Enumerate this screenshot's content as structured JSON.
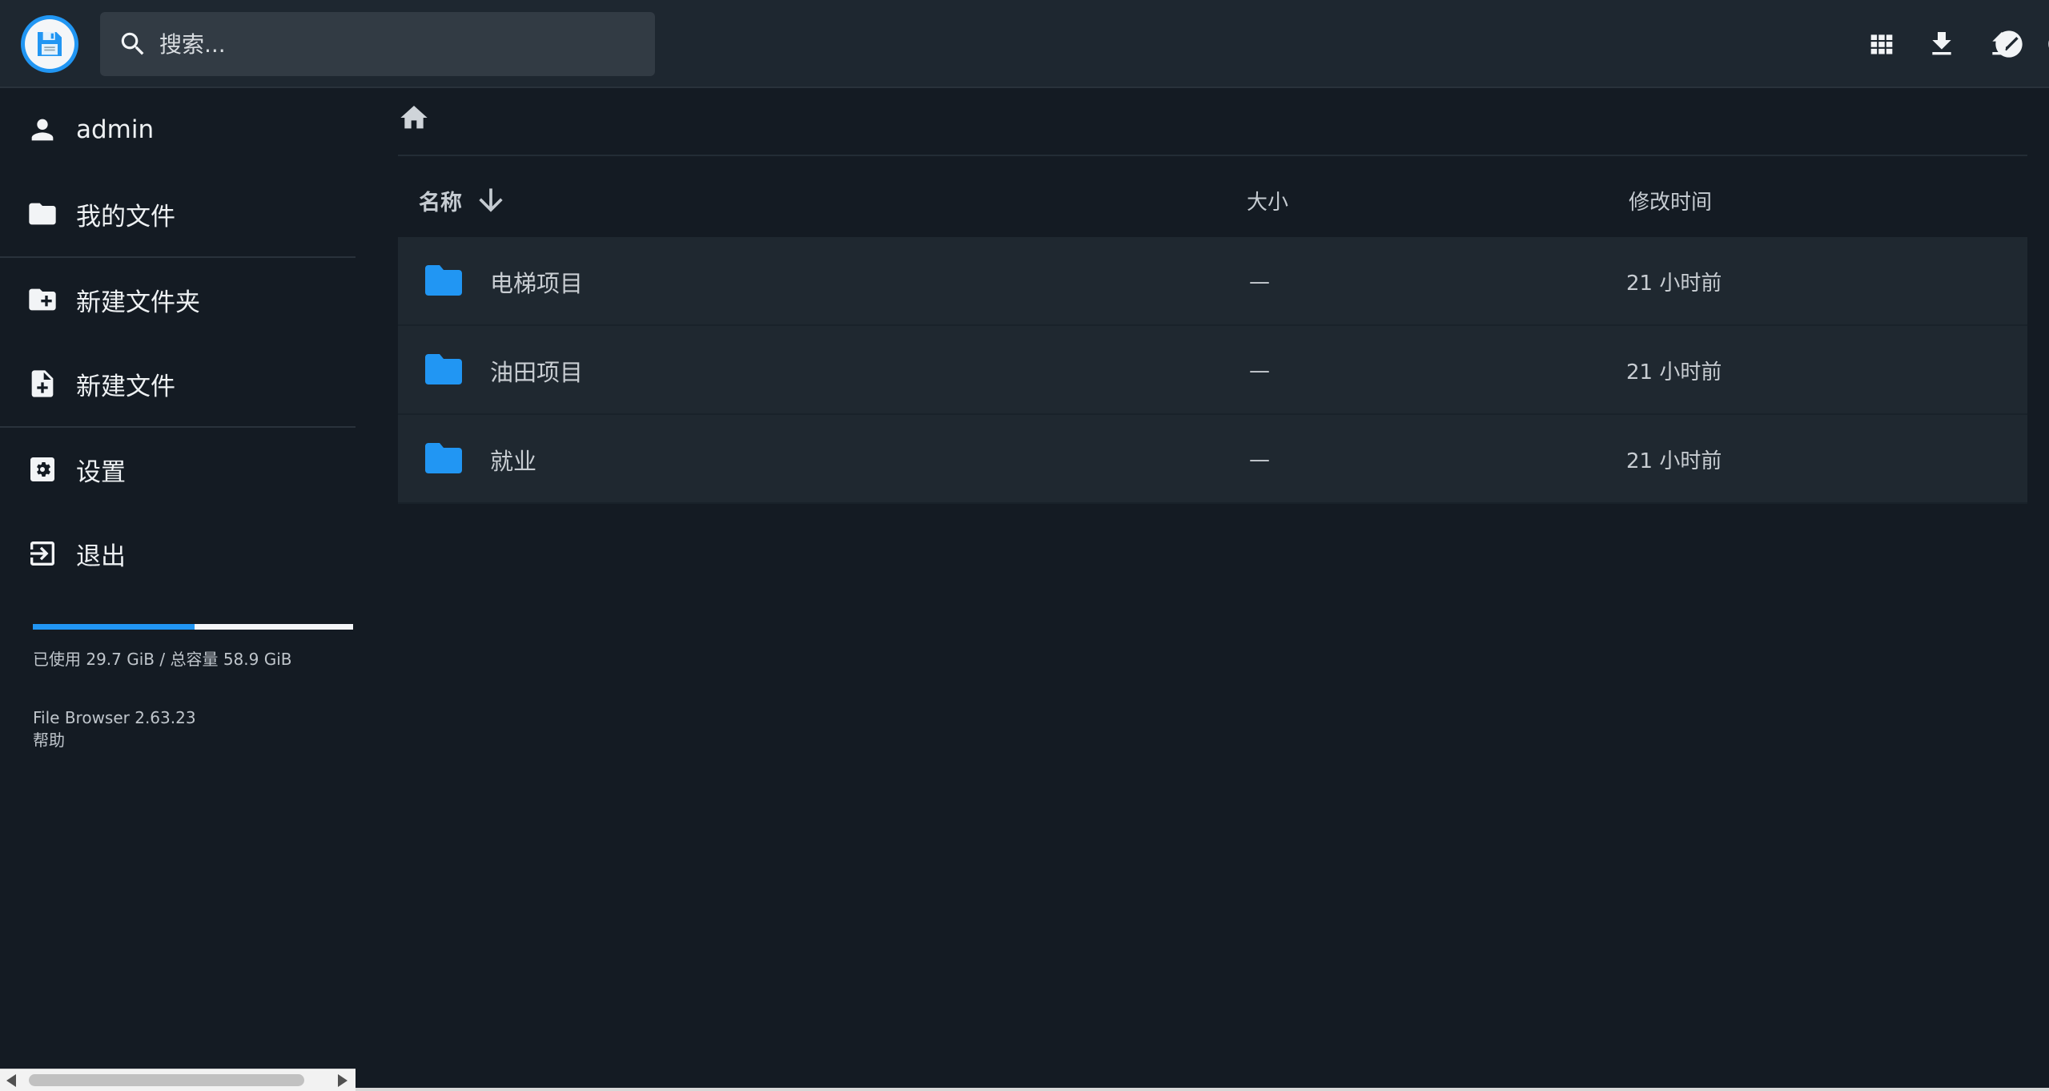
{
  "header": {
    "search_placeholder": "搜索...",
    "actions": [
      "grid-view-icon",
      "download-icon",
      "upload-icon",
      "info-icon",
      "select-icon"
    ]
  },
  "sidebar": {
    "user": "admin",
    "my_files": "我的文件",
    "new_folder": "新建文件夹",
    "new_file": "新建文件",
    "settings": "设置",
    "logout": "退出",
    "quota": {
      "used_fraction": 0.504,
      "text": "已使用 29.7 GiB / 总容量 58.9 GiB"
    },
    "version": "File Browser 2.63.23",
    "help": "帮助"
  },
  "list": {
    "columns": {
      "name": "名称",
      "size": "大小",
      "modified": "修改时间"
    },
    "items": [
      {
        "name": "电梯项目",
        "size": "—",
        "modified": "21 小时前"
      },
      {
        "name": "油田项目",
        "size": "—",
        "modified": "21 小时前"
      },
      {
        "name": "就业",
        "size": "—",
        "modified": "21 小时前"
      }
    ]
  },
  "colors": {
    "accent": "#2196f3",
    "background": "#141b23",
    "header": "#1e2730",
    "row": "#1f2830"
  }
}
